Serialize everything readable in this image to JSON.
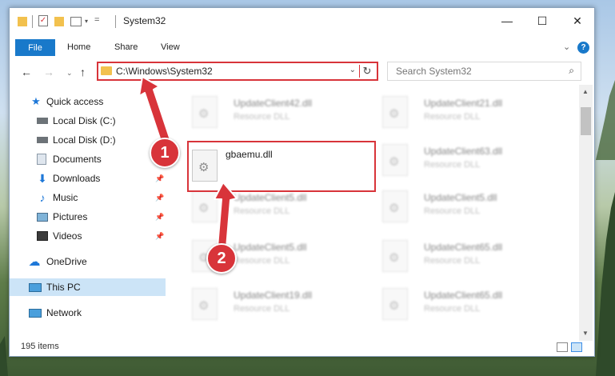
{
  "window": {
    "title": "System32",
    "controls": {
      "minimize": "—",
      "maximize": "☐",
      "close": "✕"
    }
  },
  "ribbon": {
    "file": "File",
    "tabs": [
      "Home",
      "Share",
      "View"
    ],
    "expand_icon": "chevron-down-icon",
    "help_label": "?"
  },
  "nav": {
    "address_path": "C:\\Windows\\System32",
    "search_placeholder": "Search System32"
  },
  "sidebar": {
    "items": [
      {
        "label": "Quick access",
        "icon": "star-icon",
        "pinned": false
      },
      {
        "label": "Local Disk (C:)",
        "icon": "drive-icon",
        "pinned": false
      },
      {
        "label": "Local Disk (D:)",
        "icon": "drive-icon",
        "pinned": false
      },
      {
        "label": "Documents",
        "icon": "documents-icon",
        "pinned": true
      },
      {
        "label": "Downloads",
        "icon": "download-icon",
        "pinned": true
      },
      {
        "label": "Music",
        "icon": "music-icon",
        "pinned": true
      },
      {
        "label": "Pictures",
        "icon": "pictures-icon",
        "pinned": true
      },
      {
        "label": "Videos",
        "icon": "videos-icon",
        "pinned": true
      },
      {
        "label": "OneDrive",
        "icon": "cloud-icon",
        "pinned": false
      },
      {
        "label": "This PC",
        "icon": "computer-icon",
        "pinned": false,
        "selected": true
      },
      {
        "label": "Network",
        "icon": "network-icon",
        "pinned": false
      }
    ]
  },
  "files": {
    "highlighted": {
      "name": "gbaemu.dll",
      "type": ""
    },
    "left_column": [
      {
        "name": "UpdateClient42.dll",
        "type": "Resource DLL"
      },
      {
        "name": "UpdateClient5.dll",
        "type": "Resource DLL"
      },
      {
        "name": "UpdateClient5.dll",
        "type": "Resource DLL"
      },
      {
        "name": "UpdateClient19.dll",
        "type": "Resource DLL"
      }
    ],
    "right_column": [
      {
        "name": "UpdateClient21.dll",
        "type": "Resource DLL"
      },
      {
        "name": "UpdateClient63.dll",
        "type": "Resource DLL"
      },
      {
        "name": "UpdateClient5.dll",
        "type": "Resource DLL"
      },
      {
        "name": "UpdateClient65.dll",
        "type": "Resource DLL"
      },
      {
        "name": "UpdateClient65.dll",
        "type": "Resource DLL"
      }
    ]
  },
  "status": {
    "item_count": "195 items"
  },
  "annotations": {
    "step1": "1",
    "step2": "2",
    "color": "#d8343a"
  }
}
